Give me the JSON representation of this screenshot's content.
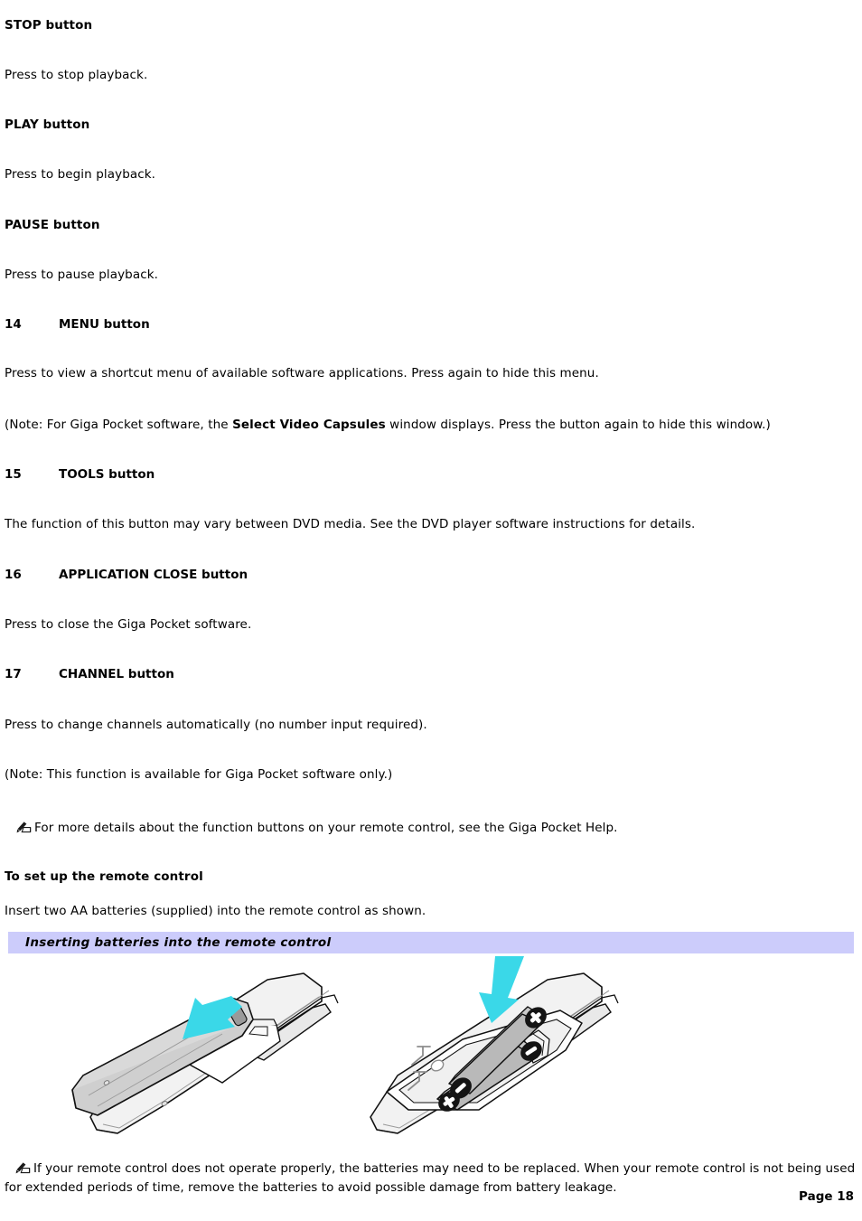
{
  "document": {
    "sections": [
      {
        "heading": "STOP button",
        "body": "Press to stop playback."
      },
      {
        "heading": "PLAY button",
        "body": "Press to begin playback."
      },
      {
        "heading": "PAUSE button",
        "body": "Press to pause playback."
      }
    ],
    "numbered_items": [
      {
        "number": "14",
        "label": "MENU button",
        "body": "Press to view a shortcut menu of available software applications. Press again to hide this menu.",
        "note_prefix": "(Note: For Giga Pocket software, the ",
        "note_bold": "Select Video Capsules",
        "note_suffix": " window displays. Press the button again to hide this window.)"
      },
      {
        "number": "15",
        "label": "TOOLS button",
        "body": "The function of this button may vary between DVD media. See the DVD player software instructions for details."
      },
      {
        "number": "16",
        "label": "APPLICATION CLOSE button",
        "body": "Press to close the Giga Pocket software."
      },
      {
        "number": "17",
        "label": "CHANNEL button",
        "body": "Press to change channels automatically (no number input required).",
        "note": "(Note: This function is available for Giga Pocket software only.)"
      }
    ],
    "tip_note": "For more details about the function buttons on your remote control, see the Giga Pocket Help.",
    "setup": {
      "heading": "To set up the remote control",
      "body": "Insert two AA batteries (supplied) into the remote control as shown."
    },
    "figure": {
      "caption": "Inserting batteries into the remote control",
      "caption_bg": "#ccccfb",
      "arrow_color": "#3ad8e8",
      "body_color": "#d2d2d2",
      "cover_color": "#c8c8c8",
      "battery_color": "#b4b4b4",
      "panels": [
        {
          "name": "remote-cover-removal",
          "alt": "Remote control with battery cover sliding off"
        },
        {
          "name": "battery-insertion",
          "alt": "Two AA batteries being inserted into open battery compartment"
        }
      ]
    },
    "battery_note": "If your remote control does not operate properly, the batteries may need to be replaced. When your remote control is not being used for extended periods of time, remove the batteries to avoid possible damage from battery leakage.",
    "footer": {
      "page_label": "Page 18"
    },
    "icons": {
      "note": "pencil-note-icon"
    }
  }
}
